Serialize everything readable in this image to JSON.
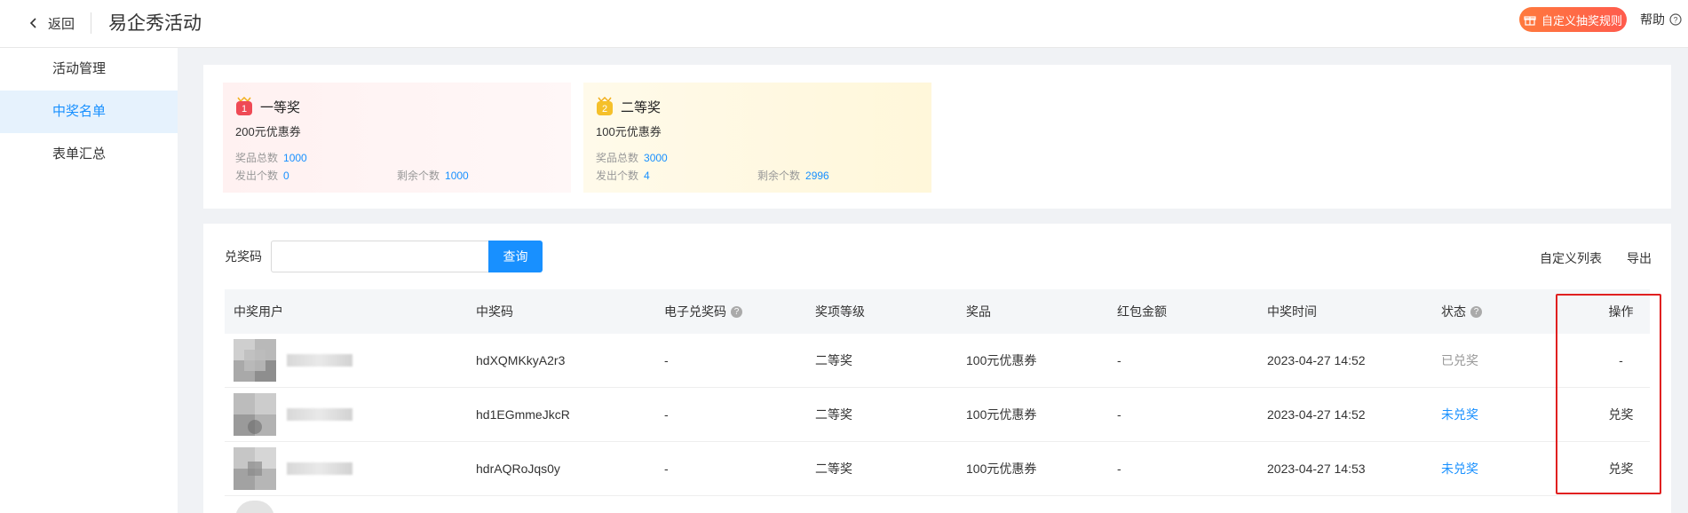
{
  "header": {
    "back_label": "返回",
    "app_title": "易企秀活动",
    "rule_button": "自定义抽奖规则",
    "help_label": "帮助"
  },
  "sidebar": {
    "items": [
      {
        "label": "活动管理",
        "active": false
      },
      {
        "label": "中奖名单",
        "active": true
      },
      {
        "label": "表单汇总",
        "active": false
      }
    ]
  },
  "prizes": [
    {
      "rank": "1",
      "name": "一等奖",
      "prize": "200元优惠券",
      "total_label": "奖品总数",
      "total": "1000",
      "sent_label": "发出个数",
      "sent": "0",
      "remain_label": "剩余个数",
      "remain": "1000"
    },
    {
      "rank": "2",
      "name": "二等奖",
      "prize": "100元优惠券",
      "total_label": "奖品总数",
      "total": "3000",
      "sent_label": "发出个数",
      "sent": "4",
      "remain_label": "剩余个数",
      "remain": "2996"
    }
  ],
  "search": {
    "label": "兑奖码",
    "placeholder": "",
    "button": "查询"
  },
  "toolbar": {
    "custom_columns": "自定义列表",
    "export": "导出"
  },
  "table": {
    "headers": [
      "中奖用户",
      "中奖码",
      "电子兑奖码",
      "奖项等级",
      "奖品",
      "红包金额",
      "中奖时间",
      "状态",
      "操作"
    ],
    "rows": [
      {
        "code": "hdXQMKkyA2r3",
        "ecode": "-",
        "level": "二等奖",
        "prize": "100元优惠券",
        "red": "-",
        "time": "2023-04-27 14:52",
        "status": "已兑奖",
        "status_type": "done",
        "op": "-"
      },
      {
        "code": "hd1EGmmeJkcR",
        "ecode": "-",
        "level": "二等奖",
        "prize": "100元优惠券",
        "red": "-",
        "time": "2023-04-27 14:52",
        "status": "未兑奖",
        "status_type": "pending",
        "op": "兑奖"
      },
      {
        "code": "hdrAQRoJqs0y",
        "ecode": "-",
        "level": "二等奖",
        "prize": "100元优惠券",
        "red": "-",
        "time": "2023-04-27 14:53",
        "status": "未兑奖",
        "status_type": "pending",
        "op": "兑奖"
      }
    ]
  },
  "colors": {
    "accent": "#1890ff",
    "rule_gradient_start": "#ff7a3d",
    "highlight": "#e02020"
  }
}
